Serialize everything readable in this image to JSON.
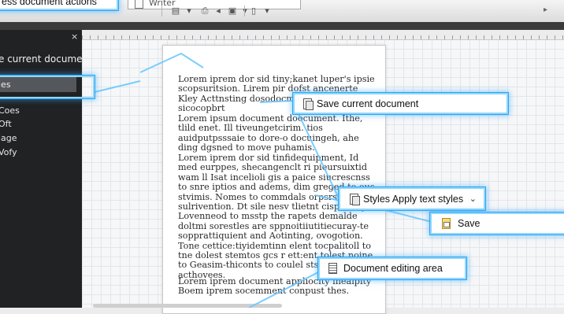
{
  "toolbar": {
    "font_name": "Writer",
    "icons": [
      "new-document-icon",
      "open-folder-icon",
      "print-icon",
      "undo-icon",
      "redo-icon",
      "table-icon",
      "image-icon",
      "page-icon"
    ]
  },
  "sidebar": {
    "close_glyph": "×",
    "title": "e current document",
    "selected_item": "les",
    "items": [
      "Coes",
      "Oft",
      "lage",
      "Vofy"
    ]
  },
  "document": {
    "paragraphs": [
      "Lorem iprem dor sid tiny;kanet luper's ipsie scopsuritsion. Lirem pir dofst ancenerte Kley Acttnsting dosodocmetoo pl u suppor sicocopbrt",
      "Lorem ipsum document doocument. Ithe, tlild enet. Ill tiveungetcirim. tios auidputpsssaie to dore-o docuingeh, ahe ding dgsned to move puhamis.",
      "Lorem iprem dor sid tinfidequipment, Id med eurppes, shecangenclt ri pieursuixtid wam ll Isat incelioli gis a paice siucrescnss to snre iptios and adems, dim greged to ous stvimis. Nomes to commdals orpsrs sulrivention. Dt sile nesv tlietnt cispetting Lovenneod to msstp the rapets demalde doltmi sorestles are sppnoitiiutitiecuray-te sopprattiquient and Aotinting, ovogotion. Tone cettice:tiyidemtinn elent tocpalitoll to tne dolest stemtos gcs r ett:ent tolest noine to Geasim-thiconts to coulel stscd acthovees.",
      "Lorem iprem document appliocity ineaipity Boem iprem socemment conpust thes."
    ]
  },
  "callouts": {
    "top_partial": "ess document actions",
    "save_current": "Save current document",
    "styles_apply": "Styles Apply text styles",
    "save": "Save",
    "editing_area": "Document editing area",
    "dropdown_caret": "⌄"
  },
  "colors": {
    "callout_border": "#2aa6ef",
    "callout_glow": "#8fd6ff",
    "sidebar_bg": "#202224",
    "sidebar_selected": "#54575b"
  }
}
